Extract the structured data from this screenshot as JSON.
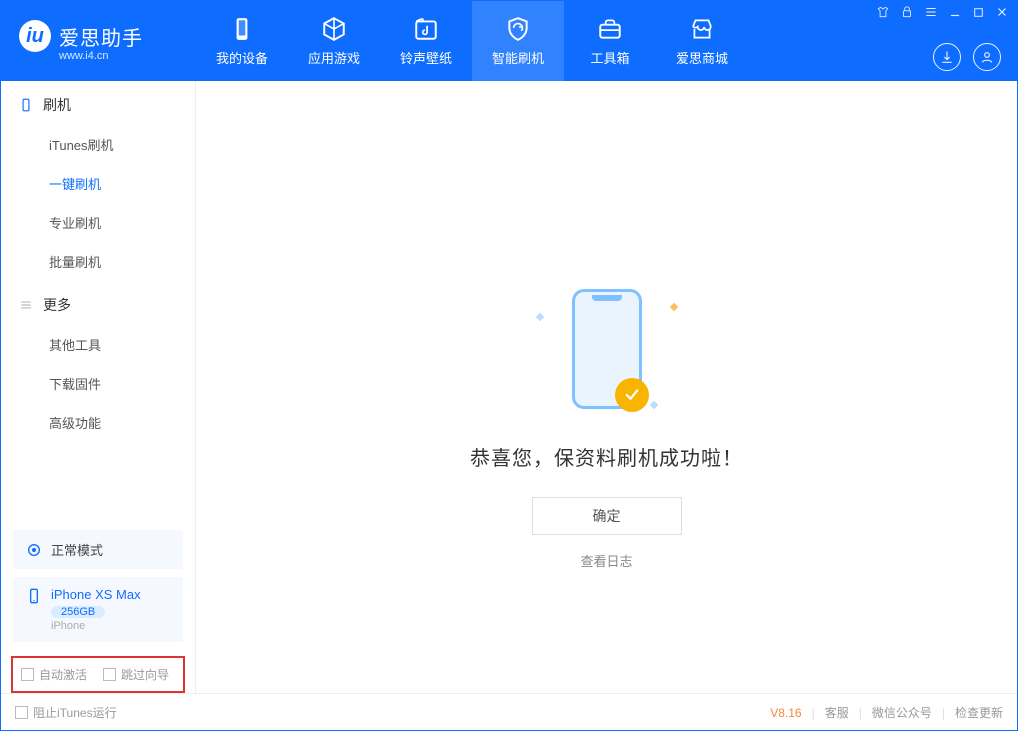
{
  "app": {
    "name": "爱思助手",
    "site": "www.i4.cn"
  },
  "tabs": [
    {
      "label": "我的设备"
    },
    {
      "label": "应用游戏"
    },
    {
      "label": "铃声壁纸"
    },
    {
      "label": "智能刷机"
    },
    {
      "label": "工具箱"
    },
    {
      "label": "爱思商城"
    }
  ],
  "sidebar": {
    "section1_title": "刷机",
    "items1": [
      "iTunes刷机",
      "一键刷机",
      "专业刷机",
      "批量刷机"
    ],
    "section2_title": "更多",
    "items2": [
      "其他工具",
      "下载固件",
      "高级功能"
    ]
  },
  "device": {
    "mode": "正常模式",
    "name": "iPhone XS Max",
    "storage": "256GB",
    "type": "iPhone"
  },
  "options": {
    "auto_activate": "自动激活",
    "skip_guide": "跳过向导"
  },
  "main": {
    "success_text": "恭喜您，保资料刷机成功啦！",
    "ok": "确定",
    "view_log": "查看日志"
  },
  "footer": {
    "block_itunes": "阻止iTunes运行",
    "version": "V8.16",
    "support": "客服",
    "wechat": "微信公众号",
    "update": "检查更新"
  }
}
